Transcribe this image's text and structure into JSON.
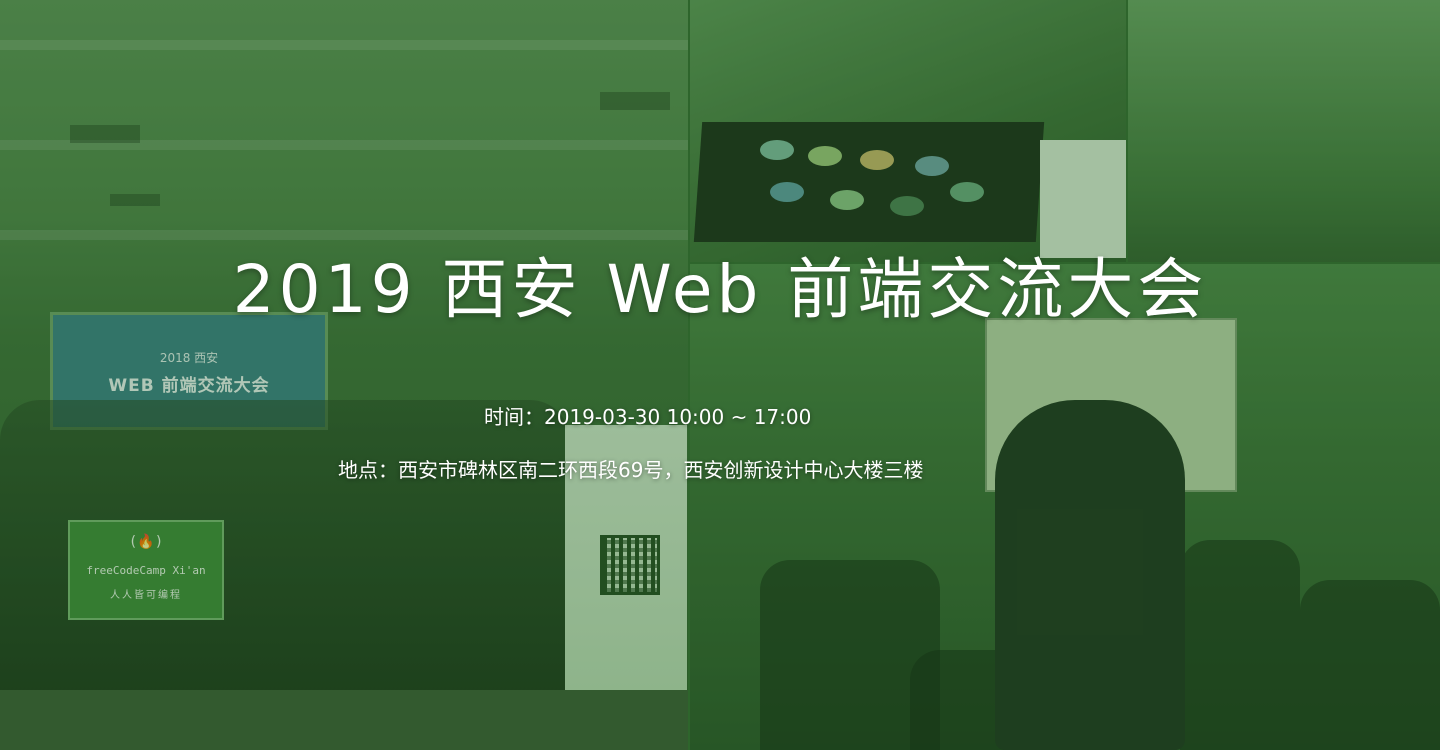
{
  "banner": {
    "title": "2019 西安 Web 前端交流大会",
    "time_label": "时间：",
    "time_value": "2019-03-30 10:00 ~ 17:00",
    "place_label": "地点：",
    "place_value": "西安市碑林区南二环西段69号，西安创新设计中心大楼三楼"
  },
  "photos": {
    "screen_line1": "2018 西安",
    "screen_line2": "WEB 前端交流大会",
    "flag_logo": "(🔥)",
    "flag_line1": "freeCodeCamp Xi'an",
    "flag_line2": "人人皆可编程"
  },
  "colors": {
    "overlay_tint": "#2e7d32",
    "text": "#ffffff"
  }
}
